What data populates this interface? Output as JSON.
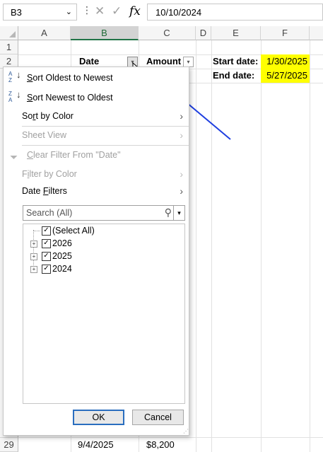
{
  "formula_bar": {
    "name_box": "B3",
    "name_box_caret": "⌄",
    "dots": "⋮",
    "cancel_icon": "✕",
    "enter_icon": "✓",
    "fx_label": "fx",
    "formula_value": "10/10/2024"
  },
  "columns": [
    "A",
    "B",
    "C",
    "D",
    "E",
    "F"
  ],
  "rows": {
    "r1": "1",
    "r2": "2",
    "r29": "29"
  },
  "cells": {
    "b2": "Date",
    "c2": "Amount",
    "e2": "Start date:",
    "f2": "1/30/2025",
    "e3": "End date:",
    "f3": "5/27/2025",
    "b29": "9/4/2025",
    "c29": "$8,200"
  },
  "colors": {
    "highlight": "#ffff00",
    "selected_header": "#217346",
    "annotation_arrow": "#1f3fe0",
    "ok_border": "#2a6ebf"
  },
  "filter_menu": {
    "sort_asc": {
      "pre": "",
      "key": "S",
      "post": "ort Oldest to Newest"
    },
    "sort_desc": {
      "pre": "",
      "key": "S",
      "post": "ort Newest to Oldest"
    },
    "sort_by_color": {
      "pre": "So",
      "key": "r",
      "post": "t by Color"
    },
    "sheet_view": "Sheet View",
    "clear_filter": {
      "pre": "",
      "key": "C",
      "post": "lear Filter From \"Date\""
    },
    "filter_by_color": {
      "pre": "F",
      "key": "i",
      "post": "lter by Color"
    },
    "date_filters": {
      "pre": "Date ",
      "key": "F",
      "post": "ilters"
    },
    "submenu_arrow": "›",
    "search_placeholder": "Search (All)",
    "search_icon": "⚲",
    "search_dropdown": "▾",
    "tree": [
      {
        "label": "(Select All)",
        "checked": true
      },
      {
        "label": "2026",
        "checked": true
      },
      {
        "label": "2025",
        "checked": true
      },
      {
        "label": "2024",
        "checked": true
      }
    ],
    "check_mark": "✓",
    "expand_mark": "+",
    "ok_label": "OK",
    "cancel_label": "Cancel",
    "resize_grip": "⋰"
  },
  "icons": {
    "filter_arrow": "▾",
    "sort_az_top": "A",
    "sort_az_bottom": "Z",
    "sort_arrow": "↓",
    "funnel": "⏷"
  }
}
